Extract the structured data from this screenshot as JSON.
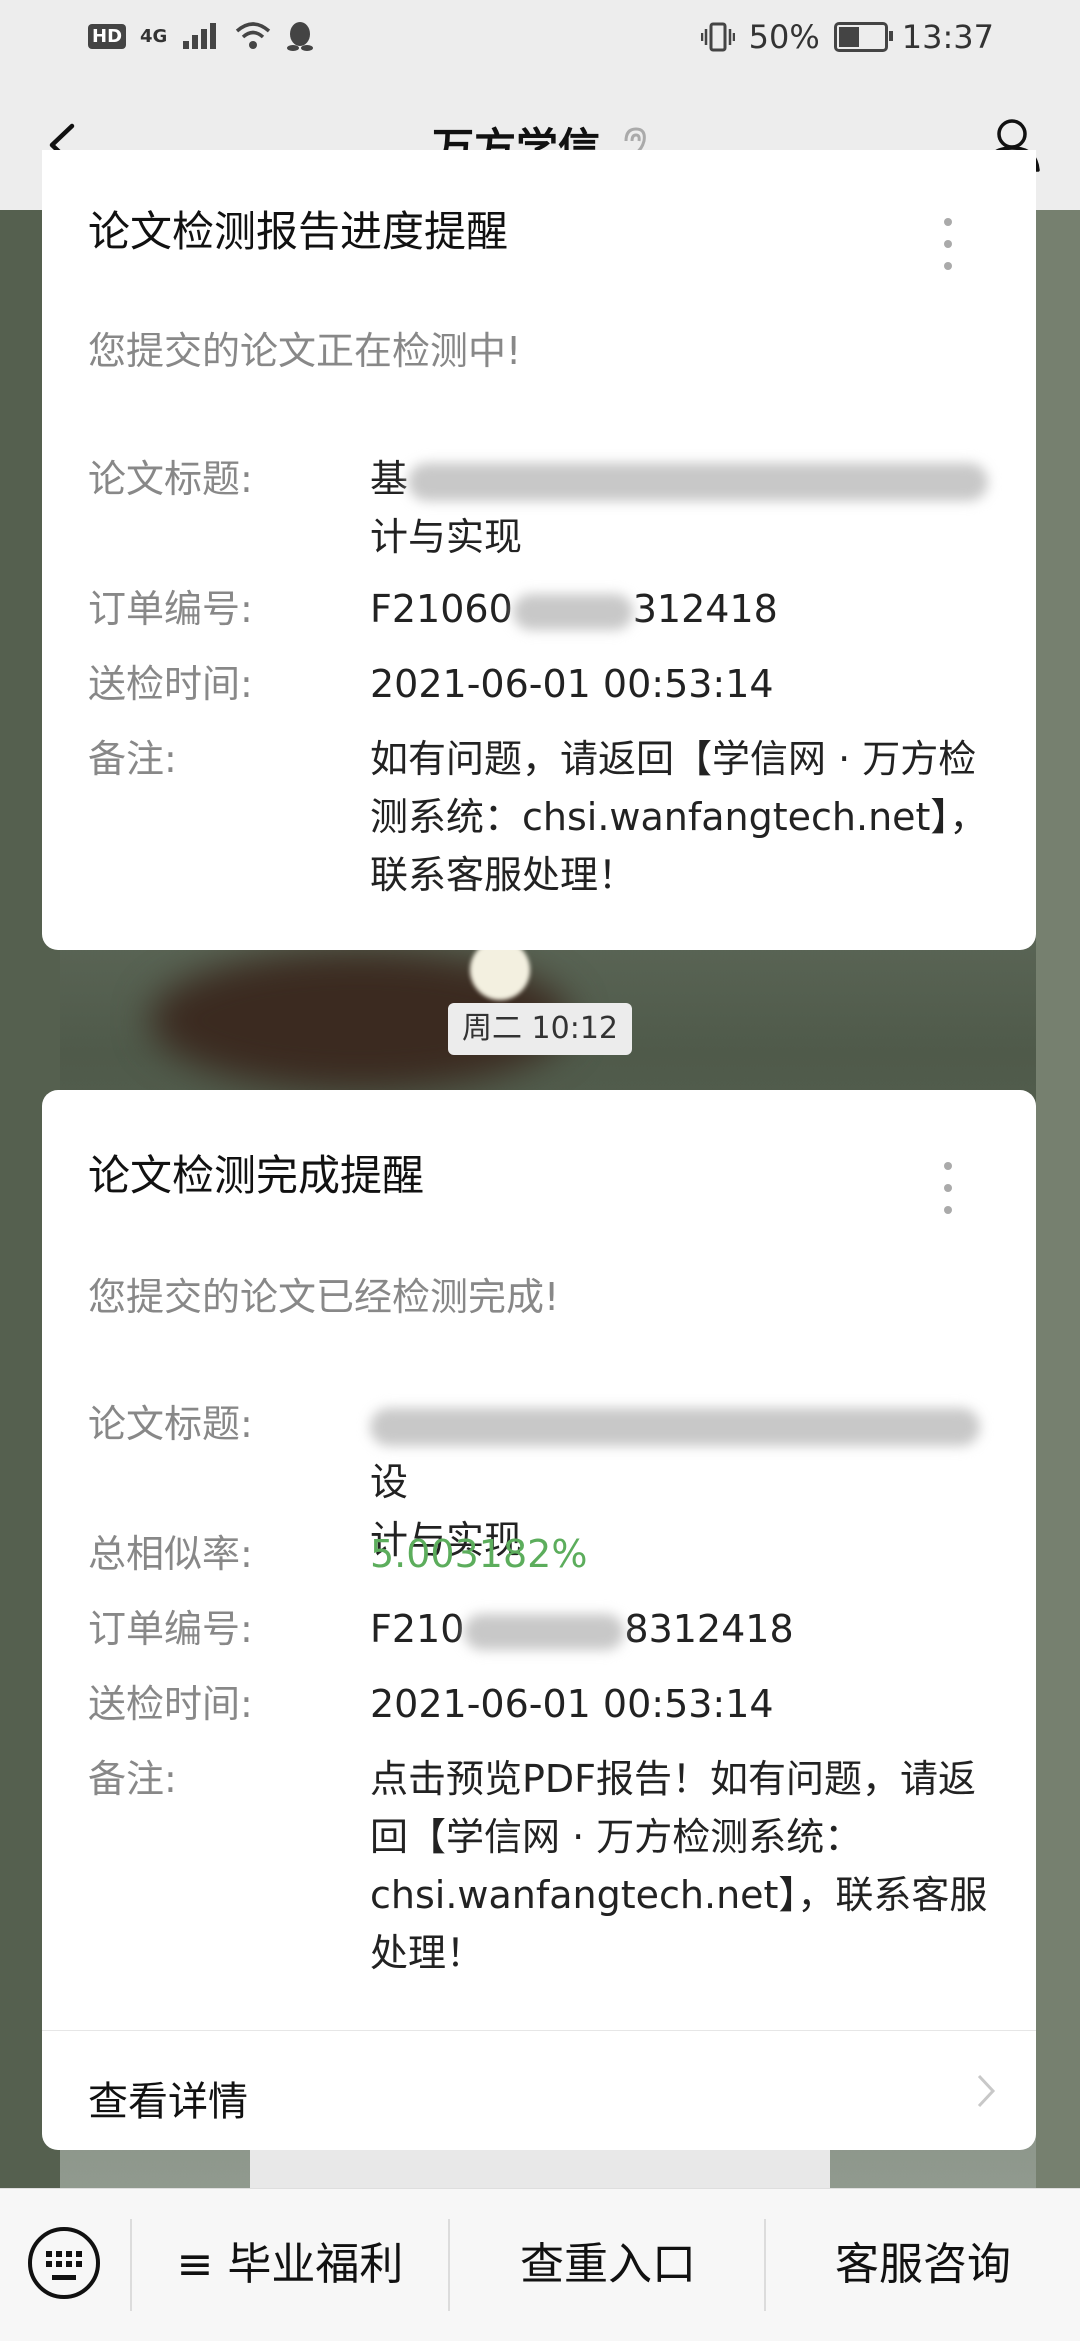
{
  "status_bar": {
    "network": "4G",
    "battery_text": "50%",
    "battery_level": 0.5,
    "time": "13:37",
    "hd_label": "HD"
  },
  "nav": {
    "title": "万方学信"
  },
  "card1": {
    "title": "论文检测报告进度提醒",
    "subtitle": "您提交的论文正在检测中!",
    "rows": [
      {
        "label": "论文标题:",
        "value_start": "基",
        "value_line2": "计与实现"
      },
      {
        "label": "订单编号:",
        "value_start": "F21060",
        "value_end": "312418"
      },
      {
        "label": "送检时间:",
        "value": "2021-06-01 00:53:14"
      },
      {
        "label": "备注:",
        "value": "如有问题，请返回【学信网 · 万方检测系统：chsi.wanfangtech.net】，联系客服处理！"
      }
    ]
  },
  "time_badge": "周二 10:12",
  "card2": {
    "title": "论文检测完成提醒",
    "subtitle": "您提交的论文已经检测完成!",
    "rows": [
      {
        "label": "论文标题:",
        "value_end": "设",
        "value_line2": "计与实现"
      },
      {
        "label": "总相似率:",
        "value": "5.003182%"
      },
      {
        "label": "订单编号:",
        "value_start": "F210",
        "value_end": "8312418"
      },
      {
        "label": "送检时间:",
        "value": "2021-06-01 00:53:14"
      },
      {
        "label": "备注:",
        "value": "点击预览PDF报告！如有问题，请返回【学信网 · 万方检测系统：chsi.wanfangtech.net】，联系客服处理！"
      }
    ],
    "detail_label": "查看详情"
  },
  "bottom_menu": {
    "items": [
      "≡ 毕业福利",
      "查重入口",
      "客服咨询"
    ]
  },
  "colors": {
    "accent_green": "#5cad5c",
    "bar_bg": "#ededed"
  }
}
